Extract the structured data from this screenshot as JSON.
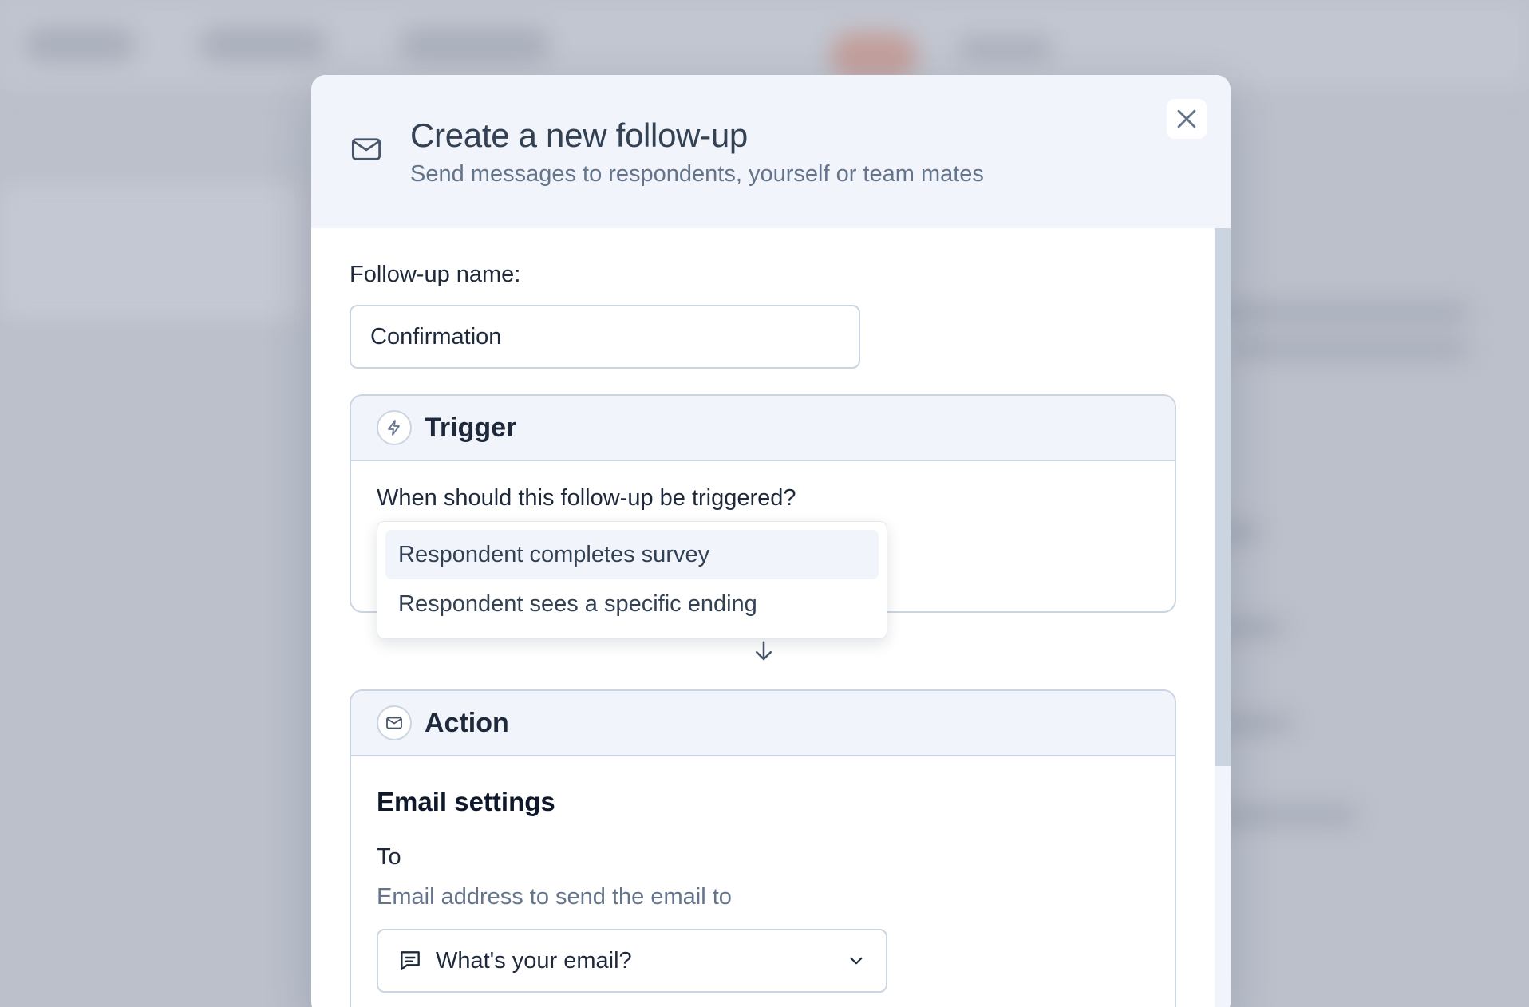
{
  "modal": {
    "title": "Create a new follow-up",
    "subtitle": "Send messages to respondents, yourself or team mates",
    "header_icon": "mail-icon",
    "close_icon": "close-icon"
  },
  "form": {
    "name_label": "Follow-up name:",
    "name_value": "Confirmation"
  },
  "trigger": {
    "title": "Trigger",
    "icon": "lightning-icon",
    "question": "When should this follow-up be triggered?",
    "options": [
      {
        "label": "Respondent completes survey",
        "highlighted": true
      },
      {
        "label": "Respondent sees a specific ending",
        "highlighted": false
      }
    ]
  },
  "action": {
    "title": "Action",
    "icon": "mail-icon",
    "section_title": "Email settings",
    "to_label": "To",
    "to_help": "Email address to send the email to",
    "to_select": {
      "icon": "message-square-icon",
      "value": "What's your email?"
    }
  },
  "colors": {
    "header_bg": "#f1f4fa",
    "border": "#cbd5e1",
    "text": "#1e293b",
    "muted": "#64748b"
  }
}
